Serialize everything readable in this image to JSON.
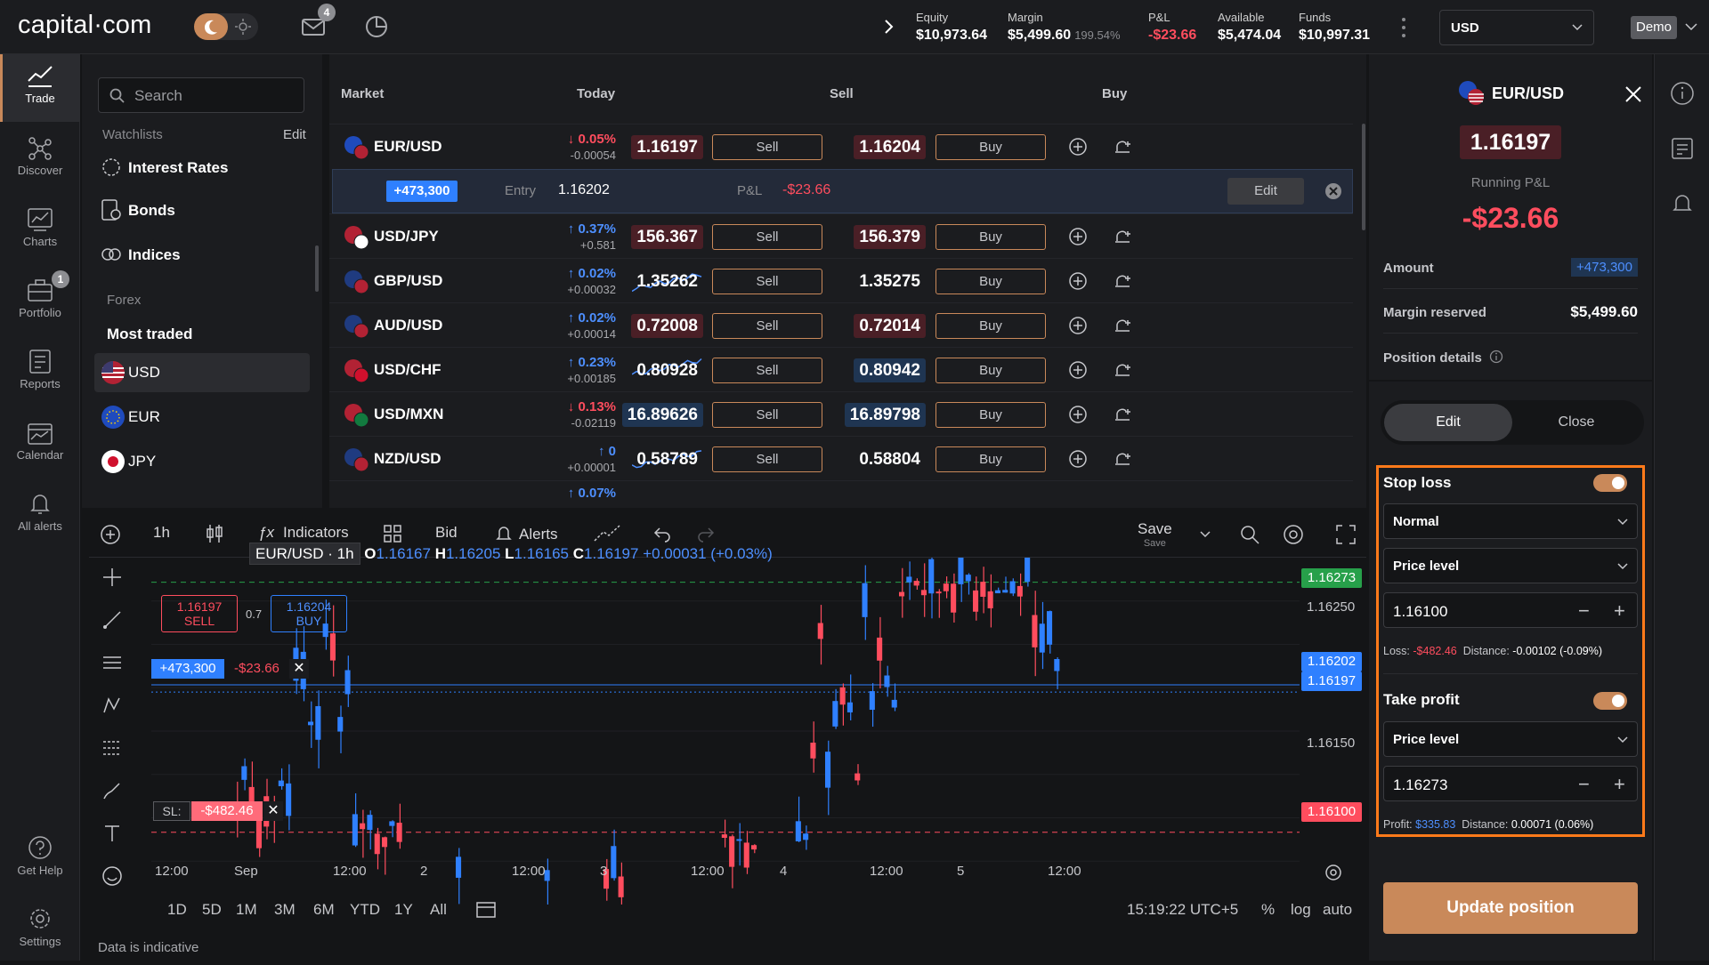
{
  "header": {
    "logo": "capital·com",
    "mail_badge": "4",
    "account": [
      {
        "label": "Equity",
        "value": "$10,973.64",
        "sub": ""
      },
      {
        "label": "Margin",
        "value": "$5,499.60",
        "sub": "199.54%"
      },
      {
        "label": "P&L",
        "value": "-$23.66",
        "sub": ""
      },
      {
        "label": "Available",
        "value": "$5,474.04",
        "sub": ""
      },
      {
        "label": "Funds",
        "value": "$10,997.31",
        "sub": ""
      }
    ],
    "currency": "USD",
    "mode": "Demo"
  },
  "rail": {
    "items": [
      "Trade",
      "Discover",
      "Charts",
      "Portfolio",
      "Reports",
      "Calendar",
      "All alerts",
      "Get Help",
      "Settings"
    ],
    "portfolio_badge": "1"
  },
  "watchlist": {
    "search_placeholder": "Search",
    "watchlists_label": "Watchlists",
    "edit_label": "Edit",
    "items": [
      "Interest Rates",
      "Bonds",
      "Indices"
    ],
    "forex_label": "Forex",
    "most_traded_label": "Most traded",
    "currencies": [
      "USD",
      "EUR",
      "JPY"
    ]
  },
  "market": {
    "headers": {
      "market": "Market",
      "today": "Today",
      "sell": "Sell",
      "buy": "Buy"
    },
    "sell_label": "Sell",
    "buy_label": "Buy",
    "rows": [
      {
        "name": "EUR/USD",
        "chg": "↓ 0.05%",
        "chgv": "-0.00054",
        "dir": "down",
        "sell": "1.16197",
        "buy": "1.16204",
        "hl": "red"
      },
      {
        "name": "USD/JPY",
        "chg": "↑ 0.37%",
        "chgv": "+0.581",
        "dir": "up",
        "sell": "156.367",
        "buy": "156.379",
        "hl": "red"
      },
      {
        "name": "GBP/USD",
        "chg": "↑ 0.02%",
        "chgv": "+0.00032",
        "dir": "up",
        "sell": "1.35262",
        "buy": "1.35275",
        "hl": "none"
      },
      {
        "name": "AUD/USD",
        "chg": "↑ 0.02%",
        "chgv": "+0.00014",
        "dir": "up",
        "sell": "0.72008",
        "buy": "0.72014",
        "hl": "red"
      },
      {
        "name": "USD/CHF",
        "chg": "↑ 0.23%",
        "chgv": "+0.00185",
        "dir": "up",
        "sell": "0.80928",
        "buy": "0.80942",
        "hl": "buyblue"
      },
      {
        "name": "USD/MXN",
        "chg": "↓ 0.13%",
        "chgv": "-0.02119",
        "dir": "down",
        "sell": "16.89626",
        "buy": "16.89798",
        "hl": "blue"
      },
      {
        "name": "NZD/USD",
        "chg": "↑ 0",
        "chgv": "+0.00001",
        "dir": "up",
        "sell": "0.58789",
        "buy": "0.58804",
        "hl": "none"
      }
    ],
    "partial_row": {
      "chg": "↑ 0.07%"
    },
    "position": {
      "amount": "+473,300",
      "entry_label": "Entry",
      "entry": "1.16202",
      "pl_label": "P&L",
      "pl": "-$23.66",
      "edit": "Edit"
    }
  },
  "chart": {
    "toolbar": {
      "timeframe": "1h",
      "indicators": "Indicators",
      "bid": "Bid",
      "alerts": "Alerts",
      "save": "Save",
      "save_sub": "Save"
    },
    "legend": {
      "symbol": "EUR/USD · 1h",
      "o": "1.16167",
      "h": "1.16205",
      "l": "1.16165",
      "c": "1.16197",
      "chg": "+0.00031 (+0.03%)"
    },
    "sell_box": {
      "price": "1.16197",
      "label": "SELL"
    },
    "spread": "0.7",
    "buy_box": {
      "price": "1.16204",
      "label": "BUY"
    },
    "position_line": {
      "amount": "+473,300",
      "pl": "-$23.66"
    },
    "sl_line": {
      "label": "SL:",
      "value": "-$482.46"
    },
    "y_labels": {
      "tp": "1.16273",
      "t1": "1.16250",
      "buy": "1.16202",
      "sell": "1.16197",
      "t2": "1.16150",
      "sl": "1.16100"
    },
    "x_ticks": [
      "12:00",
      "Sep",
      "12:00",
      "2",
      "12:00",
      "3",
      "12:00",
      "4",
      "12:00",
      "5",
      "12:00"
    ],
    "periods": [
      "1D",
      "5D",
      "1M",
      "3M",
      "6M",
      "YTD",
      "1Y",
      "All"
    ],
    "time": "15:19:22 UTC+5",
    "scale": {
      "pct": "%",
      "log": "log",
      "auto": "auto"
    },
    "disclaimer": "Data is indicative"
  },
  "chart_data": {
    "type": "candlestick",
    "title": "EUR/USD",
    "interval": "1h",
    "ylim": [
      1.1605,
      1.1629
    ],
    "last_ohlc": {
      "o": 1.16167,
      "h": 1.16205,
      "l": 1.16165,
      "c": 1.16197
    },
    "levels": {
      "take_profit": 1.16273,
      "entry": 1.16202,
      "sell": 1.16197,
      "stop_loss": 1.161
    }
  },
  "panel": {
    "symbol": "EUR/USD",
    "price": "1.16197",
    "running_pl_label": "Running P&L",
    "running_pl": "-$23.66",
    "amount_label": "Amount",
    "amount": "+473,300",
    "margin_label": "Margin reserved",
    "margin": "$5,499.60",
    "details_label": "Position details",
    "tab_edit": "Edit",
    "tab_close": "Close",
    "stop_loss": {
      "label": "Stop loss",
      "type": "Normal",
      "mode": "Price level",
      "value": "1.16100",
      "loss_label": "Loss:",
      "loss": "-$482.46",
      "distance_label": "Distance:",
      "distance": "-0.00102 (-0.09%)"
    },
    "take_profit": {
      "label": "Take profit",
      "mode": "Price level",
      "value": "1.16273",
      "profit_label": "Profit:",
      "profit": "$335.83",
      "distance_label": "Distance:",
      "distance": "0.00071 (0.06%)"
    },
    "update_button": "Update position"
  },
  "colors": {
    "accent": "#c9895a",
    "red": "#ff4d5e",
    "blue": "#2f80ff",
    "highlight": "#ff7a1a"
  }
}
